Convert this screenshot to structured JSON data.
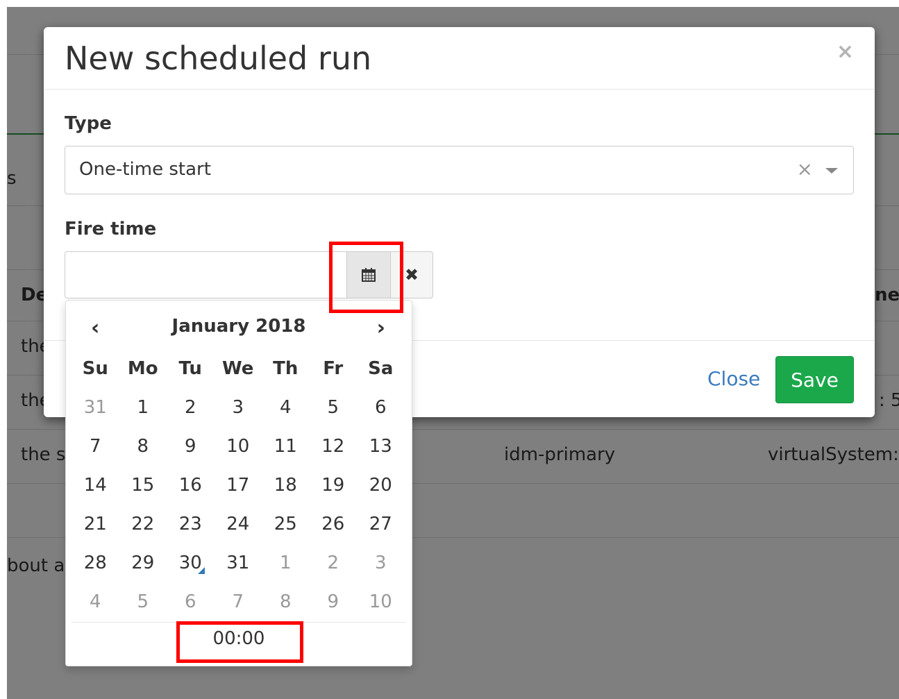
{
  "background": {
    "frag_s": "s",
    "frag_de": "De",
    "frag_the1": "the",
    "frag_the2": "the",
    "frag_the_s": "the s",
    "frag_idm": "idm-primary",
    "frag_virtual": "virtualSystem:",
    "frag_net": "net",
    "frag_5": ": 5",
    "frag_about": "bout a"
  },
  "modal": {
    "title": "New scheduled run",
    "close_symbol": "×",
    "type_label": "Type",
    "type_value": "One-time start",
    "type_clear": "×",
    "fire_time_label": "Fire time",
    "fire_time_value": "",
    "clear_button_symbol": "✖",
    "close_button": "Close",
    "save_button": "Save"
  },
  "datepicker": {
    "prev": "‹",
    "next": "›",
    "month_title": "January 2018",
    "weekdays": [
      "Su",
      "Mo",
      "Tu",
      "We",
      "Th",
      "Fr",
      "Sa"
    ],
    "weeks": [
      [
        "31",
        "1",
        "2",
        "3",
        "4",
        "5",
        "6"
      ],
      [
        "7",
        "8",
        "9",
        "10",
        "11",
        "12",
        "13"
      ],
      [
        "14",
        "15",
        "16",
        "17",
        "18",
        "19",
        "20"
      ],
      [
        "21",
        "22",
        "23",
        "24",
        "25",
        "26",
        "27"
      ],
      [
        "28",
        "29",
        "30",
        "31",
        "1",
        "2",
        "3"
      ],
      [
        "4",
        "5",
        "6",
        "7",
        "8",
        "9",
        "10"
      ]
    ],
    "today": "30",
    "time": "00:00"
  },
  "colors": {
    "overlay": "#000000",
    "save_bg": "#1aa84a",
    "link": "#3b7bbf",
    "highlight": "#ff0000",
    "today_marker": "#337ab7"
  }
}
